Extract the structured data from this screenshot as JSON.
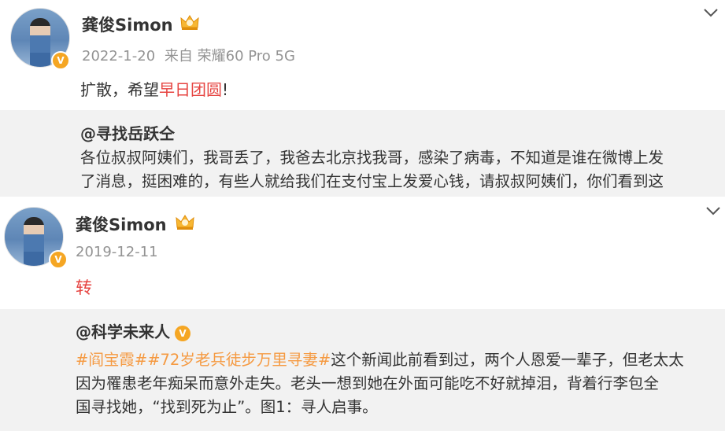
{
  "post1": {
    "author": "龚俊Simon",
    "date": "2022-1-20",
    "source": "来自 荣耀60 Pro 5G",
    "text_before": "扩散，希望",
    "text_highlight": "早日团圆",
    "text_after": "!",
    "quote": {
      "author": "@寻找岳跃仝",
      "line1": "各位叔叔阿姨们，我哥丢了，我爸去北京找我哥，感染了病毒，不知道是谁在微博上发",
      "line2": "了消息，挺困难的，有些人就给我们在支付宝上发爱心钱，请叔叔阿姨们，你们看到这"
    }
  },
  "post2": {
    "author": "龚俊Simon",
    "date": "2019-12-11",
    "text": "转",
    "quote": {
      "author": "@科学未来人",
      "tag1": "#阎宝霞#",
      "tag2": "#72岁老兵徒步万里寻妻#",
      "line1_rest": "这个新闻此前看到过，两个人恩爱一辈子，但老太太",
      "line2": "因为罹患老年痴呆而意外走失。老头一想到她在外面可能吃不好就掉泪，背着行李包全",
      "line3": "国寻找她，“找到死为止”。图1：寻人启事。"
    }
  },
  "colors": {
    "accent_red": "#e64340",
    "tag_orange": "#f59a42",
    "badge": "#f5a623",
    "quote_bg": "#f2f2f2"
  },
  "icons": [
    "avatar",
    "verified-badge-icon",
    "crown-icon",
    "chevron-down-icon"
  ]
}
